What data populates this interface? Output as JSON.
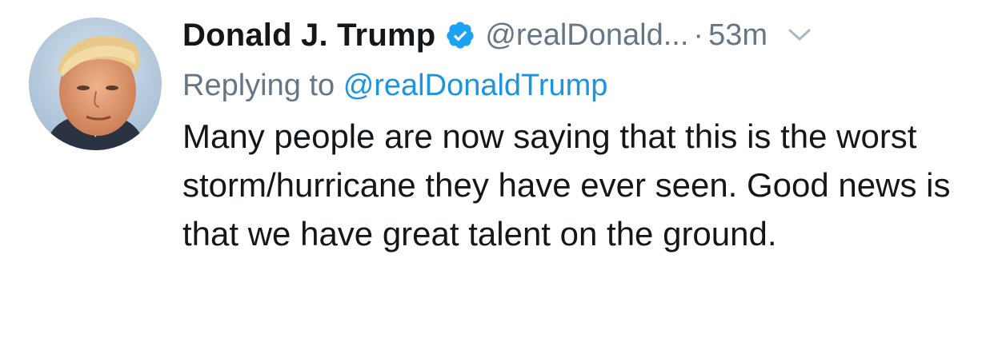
{
  "tweet": {
    "author_name": "Donald J. Trump",
    "handle": "@realDonald...",
    "separator": "·",
    "timestamp": "53m",
    "reply_prefix": "Replying to",
    "reply_mention": "@realDonaldTrump",
    "text": "Many people are now saying that this is the worst storm/hurricane they have ever seen. Good news is that we have great talent on the ground."
  },
  "icons": {
    "verified": "verified-badge-icon",
    "caret": "chevron-down-icon"
  },
  "colors": {
    "name": "#14171a",
    "secondary": "#657786",
    "link": "#1b95e0",
    "verified": "#1da1f2"
  }
}
